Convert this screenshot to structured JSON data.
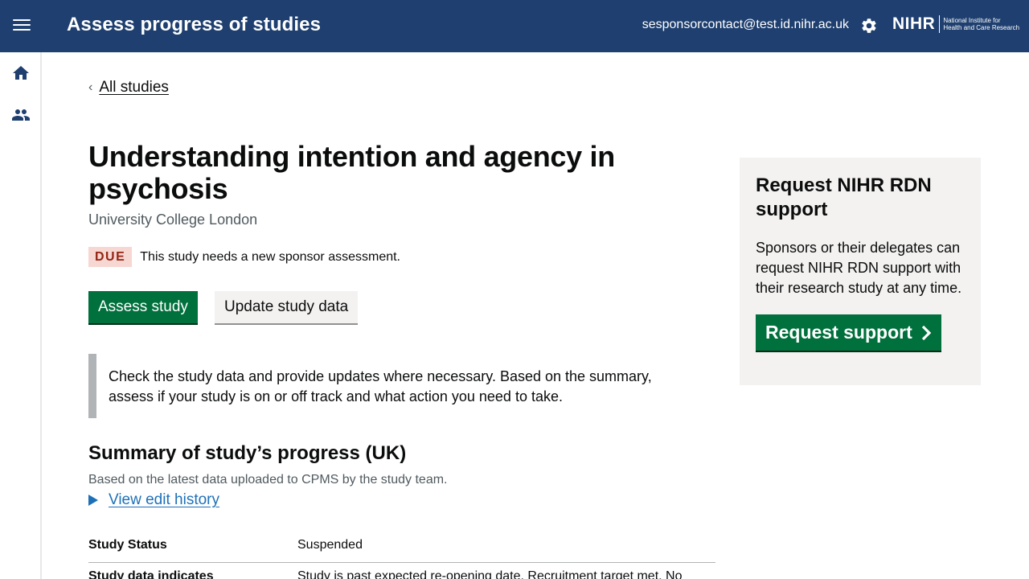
{
  "header": {
    "app_title": "Assess progress of studies",
    "user_email": "sesponsorcontact@test.id.nihr.ac.uk",
    "logo_word": "NIHR",
    "logo_sub_line1": "National Institute for",
    "logo_sub_line2": "Health and Care Research",
    "icons": [
      "menu-icon",
      "gear-icon"
    ]
  },
  "sidenav": {
    "icons": [
      "home-icon",
      "people-icon"
    ]
  },
  "back_link": "All studies",
  "study": {
    "title": "Understanding intention and agency in psychosis",
    "organisation": "University College London",
    "status_tag": "DUE",
    "status_text": "This study needs a new sponsor assessment."
  },
  "actions": {
    "assess_label": "Assess study",
    "update_label": "Update study data"
  },
  "inset_text": "Check the study data and provide updates where necessary. Based on the summary, assess if your study is on or off track and what action you need to take.",
  "summary": {
    "heading": "Summary of study’s progress (UK)",
    "subtext": "Based on the latest data uploaded to CPMS by the study team.",
    "history_link": "View edit history",
    "rows": [
      {
        "key": "Study Status",
        "value": "Suspended"
      },
      {
        "key": "Study data indicates",
        "value": "Study is past expected re-opening date. Recruitment target met. No"
      }
    ]
  },
  "panel": {
    "heading": "Request NIHR RDN support",
    "body": "Sponsors or their delegates can request NIHR RDN support with their research study at any time.",
    "button_label": "Request support"
  },
  "colors": {
    "header_bg": "#1e3f6f",
    "primary_button": "#00703c",
    "due_tag_bg": "#f6d7d2",
    "due_tag_text": "#942514",
    "link": "#1d70b8"
  }
}
